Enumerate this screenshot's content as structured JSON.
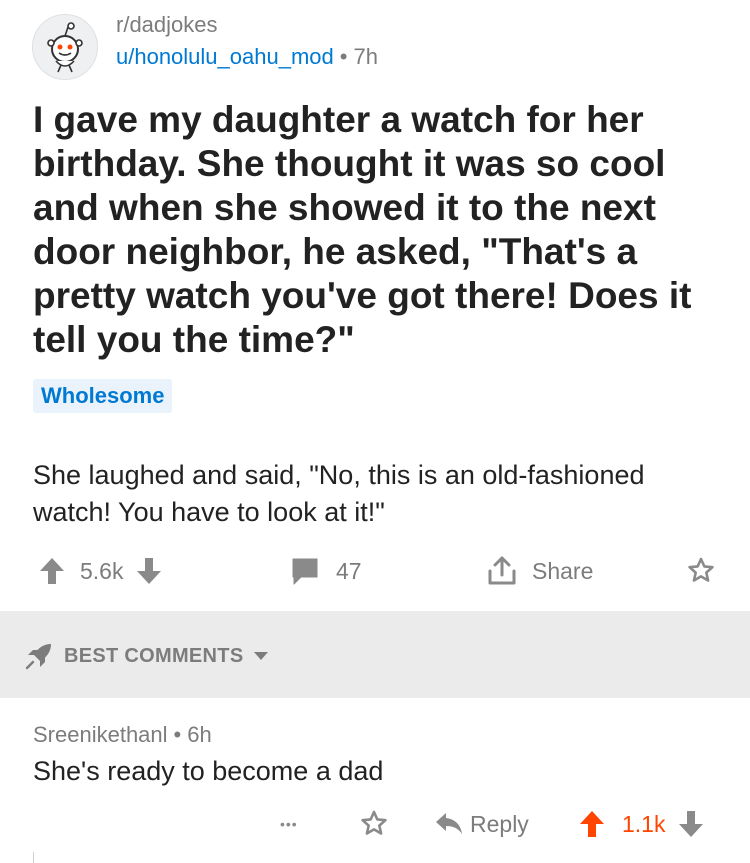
{
  "post": {
    "subreddit": "r/dadjokes",
    "author": "u/honolulu_oahu_mod",
    "separator": "•",
    "age": "7h",
    "title": "I gave my daughter a watch for her birthday. She thought it was so cool and when she showed it to the next door neighbor, he asked, \"That's a pretty watch you've got there! Does it tell you the time?\"",
    "flair": "Wholesome",
    "body": "She laughed and said, \"No, this is an old-fashioned watch! You have to look at it!\"",
    "score": "5.6k",
    "comment_count": "47",
    "share_label": "Share"
  },
  "sort": {
    "label": "BEST COMMENTS"
  },
  "comment": {
    "author": "Sreenikethanl",
    "separator": "•",
    "age": "6h",
    "text": "She's ready to become a dad",
    "more_label": "•••",
    "reply_label": "Reply",
    "score": "1.1k"
  },
  "colors": {
    "accent_blue": "#0079d3",
    "upvote_orange": "#ff4500",
    "muted_gray": "#7c7c7c",
    "band_gray": "#ebebeb"
  },
  "icons": {
    "avatar": "snoo-avatar-icon",
    "upvote": "arrow-up-icon",
    "downvote": "arrow-down-icon",
    "comments": "comment-bubble-icon",
    "share": "share-icon",
    "save": "star-icon",
    "sort": "rocket-icon",
    "dropdown": "caret-down-icon",
    "reply": "reply-arrow-icon"
  }
}
